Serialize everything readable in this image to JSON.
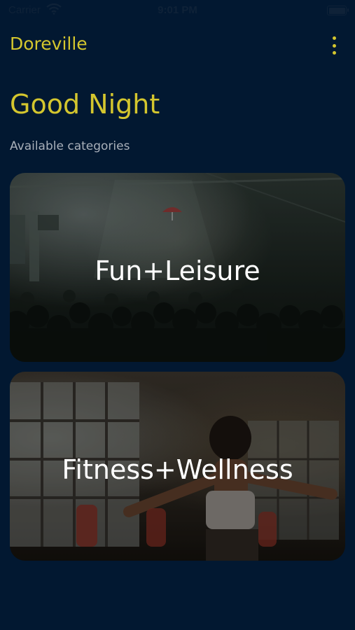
{
  "status_bar": {
    "carrier": "Carrier",
    "time": "9:01 PM"
  },
  "header": {
    "title": "Doreville",
    "menu_icon": "more-vertical-icon"
  },
  "greeting": "Good Night",
  "subtitle": "Available categories",
  "categories": [
    {
      "label": "Fun+Leisure",
      "image": "concert-crowd-photo"
    },
    {
      "label": "Fitness+Wellness",
      "image": "fitness-class-photo"
    }
  ],
  "colors": {
    "background": "#021831",
    "accent": "#d4c62e",
    "subtitle": "#a9b0ba"
  }
}
